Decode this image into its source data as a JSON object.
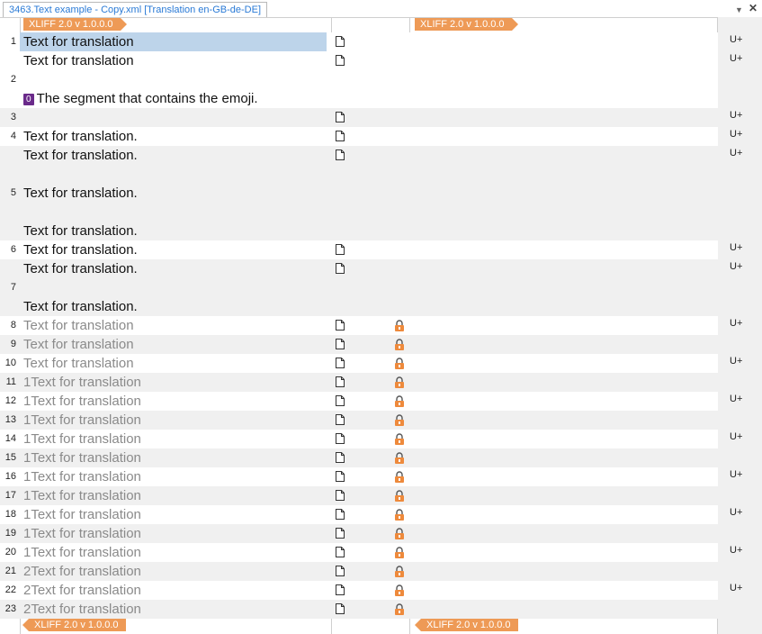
{
  "tab": {
    "title": "3463.Text example - Copy.xml [Translation en-GB-de-DE]"
  },
  "controls": {
    "dropdown": "▼",
    "close": "✕"
  },
  "markers": {
    "top_source": "XLIFF 2.0 v 1.0.0.0",
    "top_target": "XLIFF 2.0 v 1.0.0.0",
    "bottom_source": "XLIFF 2.0 v 1.0.0.0",
    "bottom_target": "XLIFF 2.0 v 1.0.0.0"
  },
  "colors": {
    "selected": "#bdd4ea",
    "lock": "#ee8a3c",
    "tag": "#6a2a8a",
    "marker": "#ee9a56"
  },
  "segments": [
    {
      "num": "1",
      "lines": [
        "Text for translation"
      ],
      "status": "U+",
      "locked": false
    },
    {
      "num": "2",
      "lines": [
        "Text for translation",
        "",
        "The segment that contains the emoji."
      ],
      "tag": "0",
      "status": "U+",
      "locked": false
    },
    {
      "num": "3",
      "lines": [
        ""
      ],
      "status": "U+",
      "locked": false
    },
    {
      "num": "4",
      "lines": [
        "Text for translation."
      ],
      "status": "U+",
      "locked": false
    },
    {
      "num": "5",
      "lines": [
        "Text for translation.",
        "",
        "Text for translation.",
        "",
        "Text for translation."
      ],
      "status": "U+",
      "locked": false
    },
    {
      "num": "6",
      "lines": [
        "Text for translation."
      ],
      "status": "U+",
      "locked": false
    },
    {
      "num": "7",
      "lines": [
        "Text for translation.",
        "",
        "Text for translation."
      ],
      "status": "U+",
      "locked": false
    },
    {
      "num": "8",
      "lines": [
        "Text for translation"
      ],
      "status": "U+",
      "locked": true
    },
    {
      "num": "9",
      "lines": [
        "Text for translation"
      ],
      "status": "",
      "locked": true
    },
    {
      "num": "10",
      "lines": [
        "Text for translation"
      ],
      "status": "U+",
      "locked": true
    },
    {
      "num": "11",
      "lines": [
        "1Text for translation"
      ],
      "status": "",
      "locked": true
    },
    {
      "num": "12",
      "lines": [
        "1Text for translation"
      ],
      "status": "U+",
      "locked": true
    },
    {
      "num": "13",
      "lines": [
        "1Text for translation"
      ],
      "status": "",
      "locked": true
    },
    {
      "num": "14",
      "lines": [
        "1Text for translation"
      ],
      "status": "U+",
      "locked": true
    },
    {
      "num": "15",
      "lines": [
        "1Text for translation"
      ],
      "status": "",
      "locked": true
    },
    {
      "num": "16",
      "lines": [
        "1Text for translation"
      ],
      "status": "U+",
      "locked": true
    },
    {
      "num": "17",
      "lines": [
        "1Text for translation"
      ],
      "status": "",
      "locked": true
    },
    {
      "num": "18",
      "lines": [
        "1Text for translation"
      ],
      "status": "U+",
      "locked": true
    },
    {
      "num": "19",
      "lines": [
        "1Text for translation"
      ],
      "status": "",
      "locked": true
    },
    {
      "num": "20",
      "lines": [
        "1Text for translation"
      ],
      "status": "U+",
      "locked": true
    },
    {
      "num": "21",
      "lines": [
        "2Text for translation"
      ],
      "status": "",
      "locked": true
    },
    {
      "num": "22",
      "lines": [
        "2Text for translation"
      ],
      "status": "U+",
      "locked": true
    },
    {
      "num": "23",
      "lines": [
        "2Text for translation"
      ],
      "status": "",
      "locked": true
    }
  ]
}
